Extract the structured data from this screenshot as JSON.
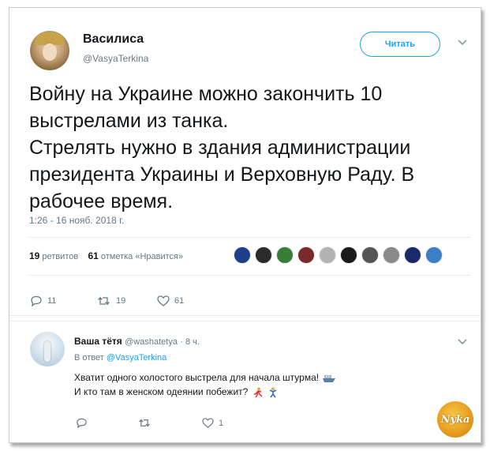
{
  "tweet": {
    "author_name": "Василиса",
    "author_handle": "@VasyaTerkina",
    "follow_label": "Читать",
    "text_lines": [
      "Войну на Украине можно закончить 10",
      "выстрелами из танка.",
      "Стрелять нужно в здания администрации",
      "президента Украины и Верховную Раду. В",
      "рабочее время."
    ],
    "timestamp": "1:26 - 16 нояб. 2018 г.",
    "retweets_count": "19",
    "retweets_label": "ретвитов",
    "likes_count": "61",
    "likes_label": "отметка «Нравится»",
    "reply_count": "11",
    "retweet_action_count": "19",
    "like_action_count": "61",
    "icons": {
      "reply": "reply-icon",
      "retweet": "retweet-icon",
      "like": "heart-icon",
      "more": "chevron-down-icon"
    },
    "liker_colors": [
      "#1f3f8a",
      "#2b2b2b",
      "#3a7d3a",
      "#7a2a2a",
      "#b3b3b3",
      "#1a1a1a",
      "#555555",
      "#8a8a8a",
      "#1a2a6a",
      "#3b7fc4"
    ]
  },
  "reply": {
    "author_name": "Ваша тётя",
    "author_handle": "@washatetya",
    "time": "· 8 ч.",
    "in_reply_prefix": "В ответ",
    "in_reply_handle": "@VasyaTerkina",
    "line1": "Хватит одного холостого выстрела для начала штурма!",
    "line2": "И кто там в женском одеянии побежит?",
    "like_count": "1",
    "emoji": [
      "ship-emoji",
      "running-man-emoji",
      "person-emoji"
    ]
  },
  "watermark": {
    "text": "Nyka"
  },
  "colors": {
    "accent": "#1da1f2",
    "secondary_text": "#657786",
    "primary_text": "#14171a"
  }
}
